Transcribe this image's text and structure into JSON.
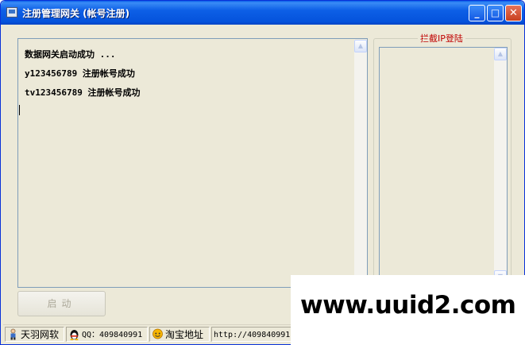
{
  "window": {
    "title": "注册管理网关 (帐号注册)",
    "controls": {
      "minimize": "_",
      "maximize": "□",
      "close": "✕"
    }
  },
  "log": {
    "lines": [
      "数据网关启动成功 ...",
      "y123456789 注册帐号成功",
      "tv123456789 注册帐号成功"
    ],
    "scroll_up": "▲"
  },
  "block_ip": {
    "label": "拦截IP登陆",
    "scroll_up": "▲",
    "scroll_down": "▼"
  },
  "start_button": {
    "label": "启动"
  },
  "statusbar": {
    "items": [
      {
        "icon": "person-icon",
        "text": "天羽网软"
      },
      {
        "icon": "qq-penguin-icon",
        "text": "QQ：409840991"
      },
      {
        "icon": "chat-bubble-icon",
        "text": "淘宝地址"
      },
      {
        "icon": "",
        "text": "http://409840991."
      }
    ]
  },
  "watermark": {
    "text": "www.uuid2.com"
  },
  "colors": {
    "titlebar": "#0553dc",
    "group_label": "#c00000",
    "disabled_text": "#aca899",
    "face": "#ece9d8"
  }
}
